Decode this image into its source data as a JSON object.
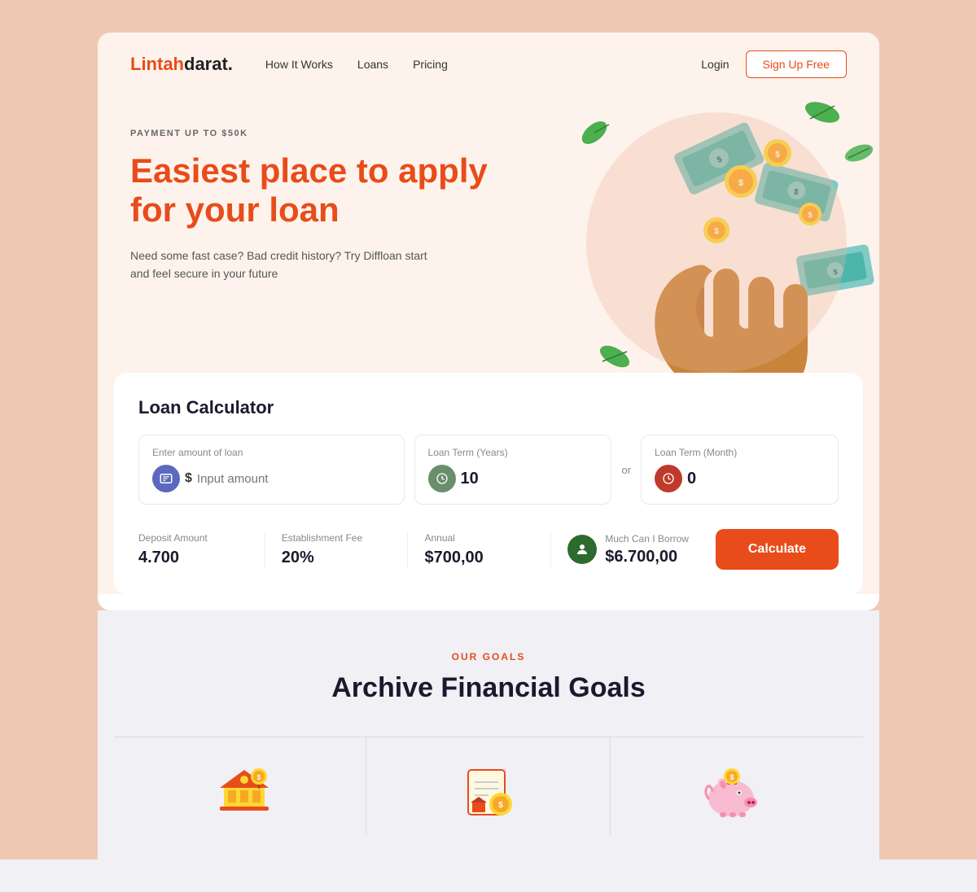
{
  "brand": {
    "name_part1": "Lintah",
    "name_part2": "darat",
    "dot": "."
  },
  "nav": {
    "links": [
      "How It Works",
      "Loans",
      "Pricing"
    ],
    "login": "Login",
    "signup": "Sign Up Free"
  },
  "hero": {
    "badge": "PAYMENT UP TO $50K",
    "title_line1": "Easiest place to apply",
    "title_line2": "for your loan",
    "description": "Need some fast case? Bad credit history? Try Diffloan start and feel secure in your future"
  },
  "calculator": {
    "title": "Loan Calculator",
    "loan_label": "Enter amount of loan",
    "loan_placeholder": "Input amount",
    "loan_prefix": "$",
    "year_label": "Loan Term (Years)",
    "year_value": "10",
    "month_label": "Loan Term (Month)",
    "month_value": "0",
    "or_text": "or",
    "deposit_label": "Deposit Amount",
    "deposit_value": "4.700",
    "fee_label": "Establishment Fee",
    "fee_value": "20%",
    "annual_label": "Annual",
    "annual_value": "$700,00",
    "borrow_label": "Much Can I Borrow",
    "borrow_value": "$6.700,00",
    "calc_button": "Calculate"
  },
  "goals": {
    "section_label": "OUR GOALS",
    "title": "Archive Financial Goals"
  },
  "colors": {
    "brand_orange": "#e84c1a",
    "dark_navy": "#1a1a2e",
    "hero_bg": "#fdf3ec",
    "gray_bg": "#f0f0f5"
  }
}
